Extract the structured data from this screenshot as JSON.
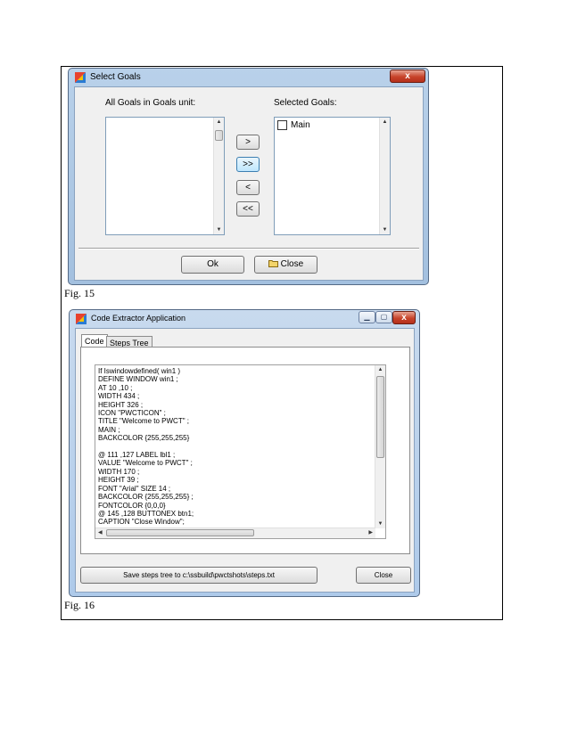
{
  "fig15": {
    "window_title": "Select Goals",
    "close_glyph": "x",
    "all_goals_label": "All Goals in Goals unit:",
    "selected_goals_label": "Selected Goals:",
    "selected_items": [
      "Main"
    ],
    "btn_add": ">",
    "btn_add_all": ">>",
    "btn_remove": "<",
    "btn_remove_all": "<<",
    "ok_label": "Ok",
    "close_label": "Close",
    "caption": "Fig. 15"
  },
  "fig16": {
    "window_title": "Code Extractor Application",
    "tabs": [
      "Code",
      "Steps Tree"
    ],
    "code_lines": [
      "If Iswindowdefined( win1 )",
      "DEFINE WINDOW win1 ;",
      "AT 10 ,10 ;",
      "WIDTH 434 ;",
      "HEIGHT 326 ;",
      "ICON \"PWCTICON\" ;",
      "TITLE \"Welcome to PWCT\" ;",
      "MAIN ;",
      "BACKCOLOR {255,255,255}",
      "",
      "@ 111 ,127 LABEL lbl1 ;",
      "VALUE \"Welcome to PWCT\" ;",
      "WIDTH 170 ;",
      "HEIGHT 39 ;",
      "FONT \"Arial\" SIZE 14 ;",
      "BACKCOLOR {255,255,255} ;",
      "FONTCOLOR {0,0,0}",
      "@ 145 ,128 BUTTONEX btn1;",
      "CAPTION \"Close Window\";"
    ],
    "save_label": "Save steps tree to c:\\ssbuild\\pwctshots\\steps.txt",
    "close_label": "Close",
    "caption": "Fig. 16"
  }
}
